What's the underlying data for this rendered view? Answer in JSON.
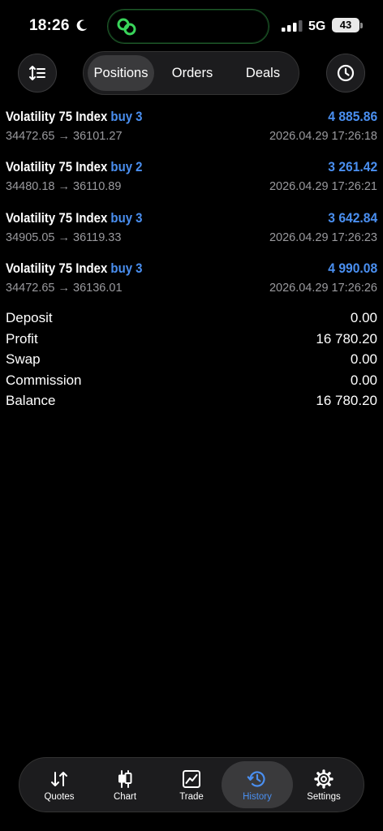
{
  "status_bar": {
    "time": "18:26",
    "network": "5G",
    "battery": "43"
  },
  "tabs": {
    "positions": "Positions",
    "orders": "Orders",
    "deals": "Deals",
    "active": "positions"
  },
  "deals": [
    {
      "symbol": "Volatility 75 Index",
      "type": "buy 3",
      "profit": "4 885.86",
      "prices": "34472.65 → 36101.27",
      "time": "2026.04.29 17:26:18"
    },
    {
      "symbol": "Volatility 75 Index",
      "type": "buy 2",
      "profit": "3 261.42",
      "prices": "34480.18 → 36110.89",
      "time": "2026.04.29 17:26:21"
    },
    {
      "symbol": "Volatility 75 Index",
      "type": "buy 3",
      "profit": "3 642.84",
      "prices": "34905.05 → 36119.33",
      "time": "2026.04.29 17:26:23"
    },
    {
      "symbol": "Volatility 75 Index",
      "type": "buy 3",
      "profit": "4 990.08",
      "prices": "34472.65 → 36136.01",
      "time": "2026.04.29 17:26:26"
    }
  ],
  "summary": {
    "deposit_label": "Deposit",
    "deposit_value": "0.00",
    "profit_label": "Profit",
    "profit_value": "16 780.20",
    "swap_label": "Swap",
    "swap_value": "0.00",
    "commission_label": "Commission",
    "commission_value": "0.00",
    "balance_label": "Balance",
    "balance_value": "16 780.20"
  },
  "bottom_nav": {
    "quotes": "Quotes",
    "chart": "Chart",
    "trade": "Trade",
    "history": "History",
    "settings": "Settings",
    "active": "history"
  },
  "colors": {
    "accent": "#4a8ff0",
    "background": "#000000",
    "secondary_text": "#9a9a9e",
    "surface": "#1c1c1e"
  },
  "icons": {
    "sort": "sort-icon",
    "clock": "clock-icon",
    "quotes": "quotes-arrows-icon",
    "chart": "candlestick-icon",
    "trade": "line-chart-icon",
    "history": "history-icon",
    "settings": "gear-icon"
  }
}
